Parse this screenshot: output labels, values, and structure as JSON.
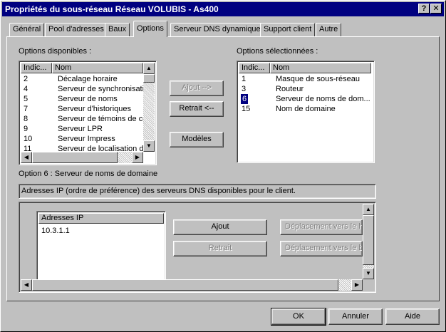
{
  "window": {
    "title": "Propriétés du sous-réseau  Réseau VOLUBIS - As400"
  },
  "title_buttons": {
    "help": "?",
    "close": "✕"
  },
  "tabs": [
    {
      "label": "Général"
    },
    {
      "label": "Pool d'adresses"
    },
    {
      "label": "Baux"
    },
    {
      "label": "Options",
      "active": true
    },
    {
      "label": "Serveur DNS dynamique"
    },
    {
      "label": "Support client"
    },
    {
      "label": "Autre"
    }
  ],
  "available": {
    "label": "Options disponibles :",
    "col_index": "Indic...",
    "col_name": "Nom",
    "rows": [
      {
        "index": "2",
        "name": "Décalage horaire"
      },
      {
        "index": "4",
        "name": "Serveur de synchronisation"
      },
      {
        "index": "5",
        "name": "Serveur de noms"
      },
      {
        "index": "7",
        "name": "Serveur d'historiques"
      },
      {
        "index": "8",
        "name": "Serveur de témoins de connexion"
      },
      {
        "index": "9",
        "name": "Serveur LPR"
      },
      {
        "index": "10",
        "name": "Serveur Impress"
      },
      {
        "index": "11",
        "name": "Serveur de localisation de ressources"
      }
    ]
  },
  "selected": {
    "label": "Options sélectionnées :",
    "col_index": "Indic...",
    "col_name": "Nom",
    "rows": [
      {
        "index": "1",
        "name": "Masque de sous-réseau"
      },
      {
        "index": "3",
        "name": "Routeur"
      },
      {
        "index": "6",
        "name": "Serveur de noms de dom...",
        "selected": true
      },
      {
        "index": "15",
        "name": "Nom de domaine"
      }
    ]
  },
  "buttons": {
    "add": "Ajout -->",
    "remove": "Retrait <--",
    "models": "Modèles"
  },
  "option_detail": {
    "title": "Option 6 :  Serveur de noms de domaine",
    "description": "Adresses IP (ordre de préférence) des serveurs DNS disponibles pour le client.",
    "list_header": "Adresses IP",
    "ips": [
      "10.3.1.1"
    ],
    "add": "Ajout",
    "remove": "Retrait",
    "move_up": "Déplacement vers le haut",
    "move_down": "Déplacement vers le bas"
  },
  "footer": {
    "ok": "OK",
    "cancel": "Annuler",
    "help": "Aide"
  }
}
